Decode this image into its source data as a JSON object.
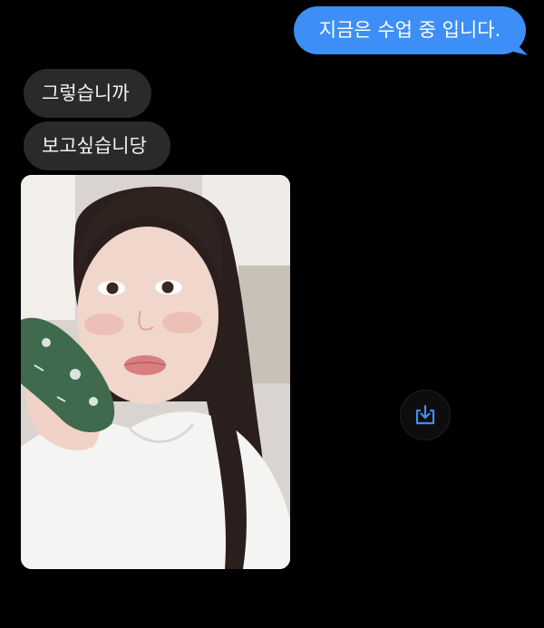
{
  "messages": {
    "sent": [
      {
        "text": "지금은 수업 중 입니다."
      }
    ],
    "received": [
      {
        "text": "그렇습니까"
      },
      {
        "text": "보고싶습니당"
      }
    ]
  },
  "photo": {
    "alt": "selfie photo"
  },
  "actions": {
    "save_icon": "download-to-tray-icon"
  },
  "colors": {
    "background": "#000000",
    "sent_bubble": "#3d8ff7",
    "received_bubble": "#2a2a2c",
    "accent": "#3d8ff7"
  }
}
